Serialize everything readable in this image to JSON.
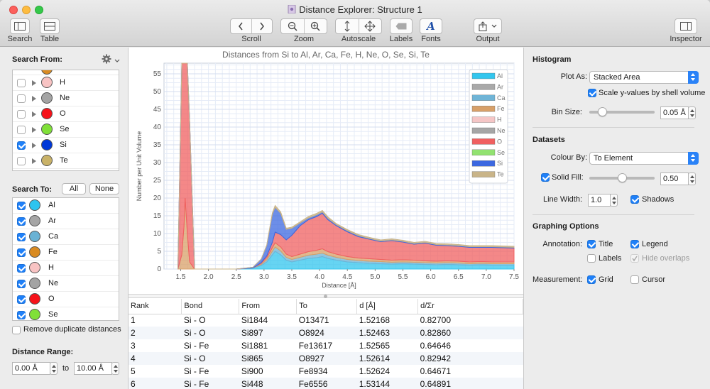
{
  "window": {
    "title": "Distance Explorer: Structure 1"
  },
  "toolbar": {
    "search": "Search",
    "table": "Table",
    "scroll": "Scroll",
    "zoom": "Zoom",
    "autoscale": "Autoscale",
    "labels": "Labels",
    "fonts": "Fonts",
    "output": "Output",
    "inspector": "Inspector"
  },
  "left": {
    "search_from_title": "Search From:",
    "search_from_items": [
      {
        "label": "H",
        "checked": false,
        "color": "#f8c3c3"
      },
      {
        "label": "Ne",
        "checked": false,
        "color": "#a3a3a3"
      },
      {
        "label": "O",
        "checked": false,
        "color": "#f6121a"
      },
      {
        "label": "Se",
        "checked": false,
        "color": "#80e038"
      },
      {
        "label": "Si",
        "checked": true,
        "color": "#0038d8"
      },
      {
        "label": "Te",
        "checked": false,
        "color": "#c9b268"
      }
    ],
    "search_to_title": "Search To:",
    "all_btn": "All",
    "none_btn": "None",
    "search_to_items": [
      {
        "label": "Al",
        "checked": true,
        "color": "#2dc4ef"
      },
      {
        "label": "Ar",
        "checked": true,
        "color": "#a5a5a5"
      },
      {
        "label": "Ca",
        "checked": true,
        "color": "#6ab2d4"
      },
      {
        "label": "Fe",
        "checked": true,
        "color": "#d98b22"
      },
      {
        "label": "H",
        "checked": true,
        "color": "#f8c3c3"
      },
      {
        "label": "Ne",
        "checked": true,
        "color": "#a3a3a3"
      },
      {
        "label": "O",
        "checked": true,
        "color": "#f6121a"
      },
      {
        "label": "Se",
        "checked": true,
        "color": "#80e038"
      }
    ],
    "remove_duplicates": "Remove duplicate distances",
    "distance_range_title": "Distance Range:",
    "range_from": "0.00 Å",
    "range_to_word": "to",
    "range_to": "10.00 Å"
  },
  "chart_data": {
    "type": "area",
    "title": "Distances from Si to Al, Ar, Ca, Fe, H, Ne, O, Se, Si, Te",
    "xlabel": "Distance [Å]",
    "ylabel": "Number per Unit Volume",
    "xlim": [
      1.2,
      7.5
    ],
    "ylim": [
      0,
      58
    ],
    "xticks": [
      "1.5",
      "2.0",
      "2.5",
      "3.0",
      "3.5",
      "4.0",
      "4.5",
      "5.0",
      "5.5",
      "6.0",
      "6.5",
      "7.0",
      "7.5"
    ],
    "yticks": [
      "0",
      "5",
      "10",
      "15",
      "20",
      "25",
      "30",
      "35",
      "40",
      "45",
      "50",
      "55"
    ],
    "grid": true,
    "legend_position": "top-right",
    "legend": [
      {
        "name": "Al",
        "color": "#33c6ee"
      },
      {
        "name": "Ar",
        "color": "#a9a9a9"
      },
      {
        "name": "Ca",
        "color": "#6fb4d6"
      },
      {
        "name": "Fe",
        "color": "#d8a068"
      },
      {
        "name": "H",
        "color": "#f5c6c6"
      },
      {
        "name": "Ne",
        "color": "#a6a6a6"
      },
      {
        "name": "O",
        "color": "#f06060"
      },
      {
        "name": "Se",
        "color": "#92e270"
      },
      {
        "name": "Si",
        "color": "#3c68e0"
      },
      {
        "name": "Te",
        "color": "#c9b488"
      }
    ],
    "x": [
      1.45,
      1.52,
      1.56,
      1.58,
      1.62,
      1.66,
      1.75,
      2.5,
      2.8,
      2.95,
      3.05,
      3.15,
      3.2,
      3.3,
      3.4,
      3.5,
      3.65,
      3.8,
      3.95,
      4.05,
      4.15,
      4.3,
      4.5,
      4.7,
      4.9,
      5.1,
      5.3,
      5.5,
      5.7,
      5.9,
      6.1,
      6.3,
      6.5,
      6.7,
      6.9,
      7.1,
      7.3,
      7.5
    ],
    "series": [
      {
        "name": "Al",
        "values": [
          0,
          0,
          0,
          0,
          0,
          0,
          0,
          0,
          0.3,
          1,
          2,
          4,
          5,
          4,
          2.5,
          2,
          2.5,
          3,
          3.2,
          3.5,
          3,
          2.5,
          2,
          1.8,
          1.6,
          1.5,
          1.4,
          1.5,
          1.4,
          1.3,
          1.2,
          1.3,
          1.2,
          1.1,
          1.2,
          1.1,
          1.1,
          1.1
        ]
      },
      {
        "name": "Ca",
        "values": [
          0,
          0,
          0,
          0,
          0,
          0,
          0,
          0,
          0,
          0.3,
          0.6,
          1,
          1.2,
          1.1,
          0.8,
          0.7,
          0.8,
          0.9,
          1,
          1,
          0.9,
          0.8,
          0.7,
          0.6,
          0.6,
          0.6,
          0.5,
          0.5,
          0.5,
          0.5,
          0.5,
          0.5,
          0.5,
          0.4,
          0.4,
          0.4,
          0.4,
          0.4
        ]
      },
      {
        "name": "Fe",
        "values": [
          0,
          4,
          12,
          20,
          10,
          2,
          0,
          0,
          0,
          0.3,
          0.6,
          1,
          1.2,
          1.1,
          0.9,
          0.8,
          0.9,
          1,
          1.1,
          1.2,
          1,
          0.9,
          0.8,
          0.7,
          0.7,
          0.6,
          0.6,
          0.6,
          0.6,
          0.5,
          0.5,
          0.5,
          0.5,
          0.5,
          0.5,
          0.5,
          0.5,
          0.5
        ]
      },
      {
        "name": "O",
        "values": [
          0,
          56,
          58,
          58,
          58,
          40,
          0,
          0,
          0,
          0.2,
          0.5,
          1.5,
          3,
          3.5,
          4,
          6,
          8,
          9,
          9.5,
          10,
          9,
          8,
          7,
          6,
          5.5,
          5,
          5.5,
          5,
          4.5,
          5,
          4.5,
          4.3,
          4.2,
          4.1,
          4,
          4.1,
          4,
          3.9
        ]
      },
      {
        "name": "Si",
        "values": [
          0,
          0,
          0,
          0,
          0,
          0,
          0,
          0,
          0.2,
          1,
          3,
          8,
          7,
          6,
          3,
          2,
          0.8,
          0.5,
          0.5,
          0.4,
          0.4,
          0.3,
          0.3,
          0.3,
          0.2,
          0.2,
          0.2,
          0.2,
          0.2,
          0.2,
          0.2,
          0.2,
          0.2,
          0.2,
          0.2,
          0.2,
          0.2,
          0.2
        ]
      },
      {
        "name": "Te",
        "values": [
          0,
          0,
          0,
          0,
          0,
          0,
          0,
          0,
          0,
          0,
          0.1,
          0.3,
          0.5,
          0.4,
          0.3,
          0.3,
          0.3,
          0.4,
          0.4,
          0.4,
          0.4,
          0.3,
          0.3,
          0.3,
          0.3,
          0.3,
          0.3,
          0.3,
          0.3,
          0.3,
          0.3,
          0.3,
          0.3,
          0.3,
          0.3,
          0.3,
          0.3,
          0.3
        ]
      }
    ]
  },
  "table": {
    "headers": [
      "Rank",
      "Bond",
      "From",
      "To",
      "d [Å]",
      "d/Σr"
    ],
    "rows": [
      [
        "1",
        "Si - O",
        "Si1844",
        "O13471",
        "1.52168",
        "0.82700"
      ],
      [
        "2",
        "Si - O",
        "Si897",
        "O8924",
        "1.52463",
        "0.82860"
      ],
      [
        "3",
        "Si - Fe",
        "Si1881",
        "Fe13617",
        "1.52565",
        "0.64646"
      ],
      [
        "4",
        "Si - O",
        "Si865",
        "O8927",
        "1.52614",
        "0.82942"
      ],
      [
        "5",
        "Si - Fe",
        "Si900",
        "Fe8934",
        "1.52624",
        "0.64671"
      ],
      [
        "6",
        "Si - Fe",
        "Si448",
        "Fe6556",
        "1.53144",
        "0.64891"
      ]
    ]
  },
  "right": {
    "histogram_title": "Histogram",
    "plot_as_label": "Plot As:",
    "plot_as_value": "Stacked Area",
    "scale_label": "Scale y-values by shell volume",
    "bin_size_label": "Bin Size:",
    "bin_size_value": "0.05 Å",
    "bin_size_fraction": 0.05,
    "datasets_title": "Datasets",
    "colour_by_label": "Colour By:",
    "colour_by_value": "To Element",
    "solid_fill_label": "Solid Fill:",
    "solid_fill_value": "0.50",
    "solid_fill_fraction": 0.5,
    "line_width_label": "Line Width:",
    "line_width_value": "1.0",
    "shadows_label": "Shadows",
    "graphing_title": "Graphing Options",
    "annotation_label": "Annotation:",
    "title_label": "Title",
    "legend_label": "Legend",
    "labels_label": "Labels",
    "hide_overlaps_label": "Hide overlaps",
    "measurement_label": "Measurement:",
    "grid_label": "Grid",
    "cursor_label": "Cursor"
  }
}
